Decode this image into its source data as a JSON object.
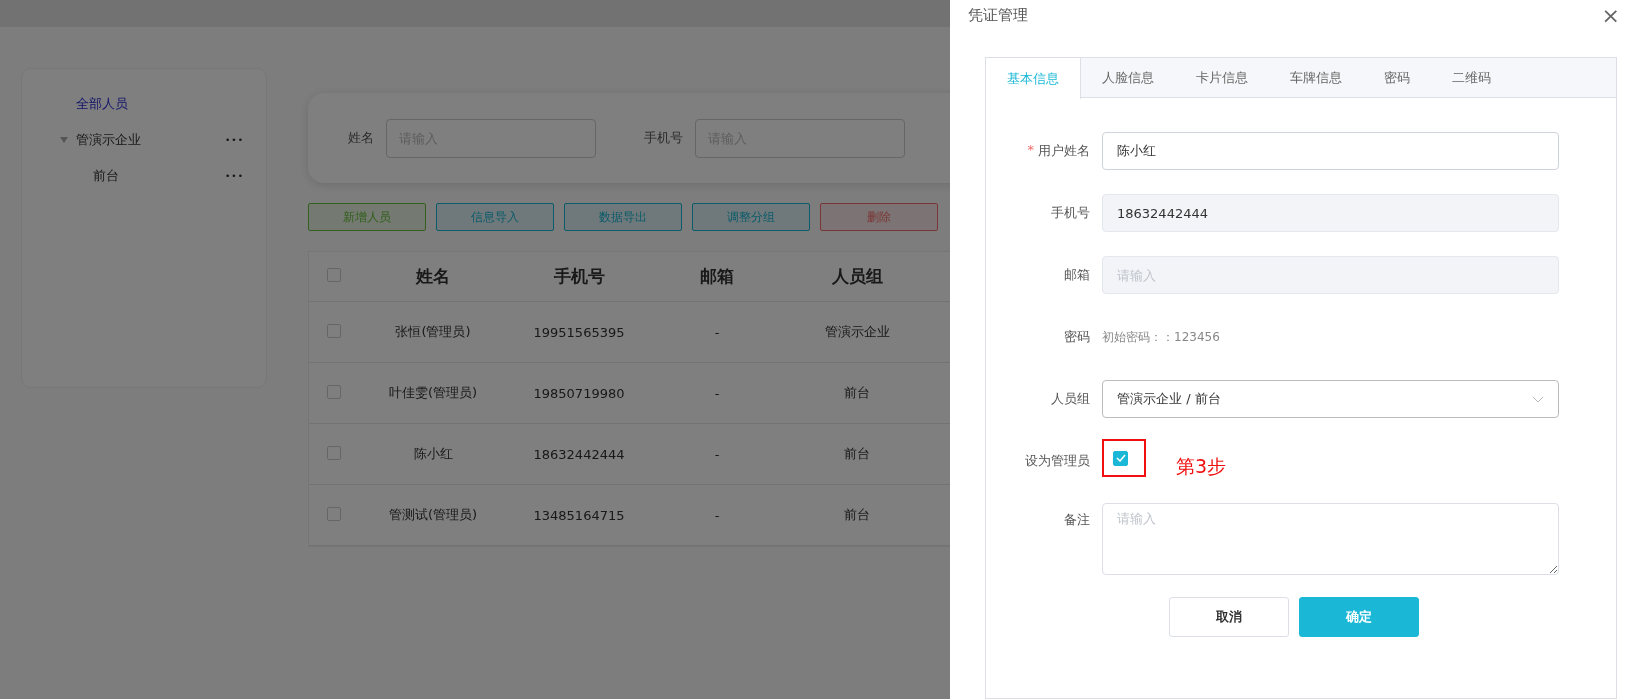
{
  "sidebar": {
    "items": [
      {
        "label": "全部人员",
        "selected": true
      },
      {
        "label": "管演示企业",
        "selected": false,
        "expanded": true,
        "more": "•••",
        "children": [
          {
            "label": "前台",
            "selected": false,
            "more": "•••"
          }
        ]
      }
    ]
  },
  "search": {
    "fields": [
      {
        "label": "姓名",
        "placeholder": "请输入"
      },
      {
        "label": "手机号",
        "placeholder": "请输入"
      }
    ]
  },
  "toolbar": {
    "buttons": [
      {
        "label": "新增人员",
        "kind": "success"
      },
      {
        "label": "信息导入",
        "kind": "info"
      },
      {
        "label": "数据导出",
        "kind": "info"
      },
      {
        "label": "调整分组",
        "kind": "info"
      },
      {
        "label": "删除",
        "kind": "danger"
      }
    ]
  },
  "table": {
    "columns": [
      "姓名",
      "手机号",
      "邮箱",
      "人员组"
    ],
    "all_checked": false,
    "rows": [
      {
        "checked": false,
        "cells": [
          "张恒(管理员)",
          "19951565395",
          "-",
          "管演示企业"
        ]
      },
      {
        "checked": false,
        "cells": [
          "叶佳雯(管理员)",
          "19850719980",
          "-",
          "前台"
        ]
      },
      {
        "checked": false,
        "cells": [
          "陈小红",
          "18632442444",
          "-",
          "前台"
        ]
      },
      {
        "checked": false,
        "cells": [
          "管测试(管理员)",
          "13485164715",
          "-",
          "前台"
        ]
      }
    ]
  },
  "drawer": {
    "title": "凭证管理",
    "close": "×",
    "tabs": [
      {
        "label": "基本信息",
        "selected": true
      },
      {
        "label": "人脸信息",
        "selected": false
      },
      {
        "label": "卡片信息",
        "selected": false
      },
      {
        "label": "车牌信息",
        "selected": false
      },
      {
        "label": "密码",
        "selected": false
      },
      {
        "label": "二维码",
        "selected": false
      }
    ],
    "form": [
      {
        "kind": "input",
        "label": "用户姓名",
        "required_mark": "*",
        "value": "陈小红",
        "disabled": false
      },
      {
        "kind": "input",
        "label": "手机号",
        "value": "18632442444",
        "disabled": true
      },
      {
        "kind": "input",
        "label": "邮箱",
        "placeholder": "请输入",
        "disabled": true
      },
      {
        "kind": "text",
        "label": "密码",
        "value": "初始密码：：123456"
      },
      {
        "kind": "select",
        "label": "人员组",
        "value": "管演示企业 / 前台"
      },
      {
        "kind": "checkbox",
        "label": "设为管理员",
        "checked": true,
        "annotation": "第3步"
      },
      {
        "kind": "textarea",
        "label": "备注",
        "placeholder": "请输入"
      }
    ],
    "buttons": [
      {
        "label": "取消",
        "primary": false
      },
      {
        "label": "确定",
        "primary": true
      }
    ]
  }
}
